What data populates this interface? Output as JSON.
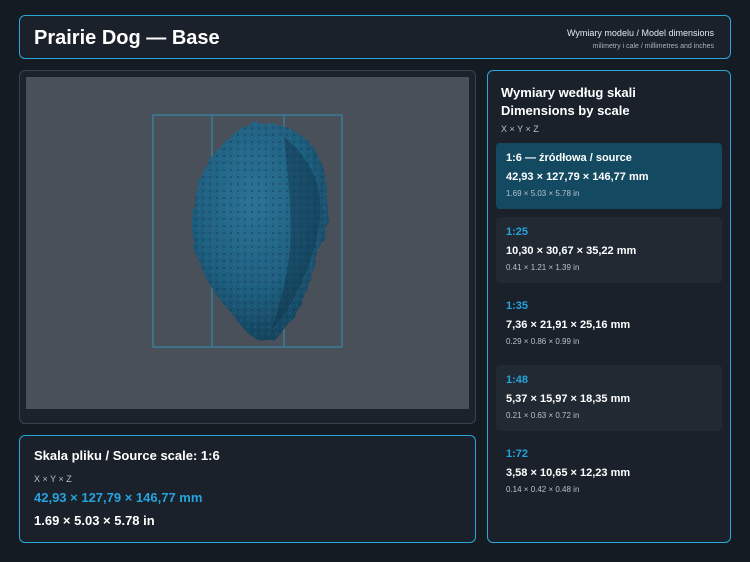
{
  "header": {
    "title": "Prairie Dog — Base",
    "subtitle_primary": "Wymiary modelu / Model dimensions",
    "subtitle_secondary": "milimetry i cale / millimetres and inches"
  },
  "viewer": {
    "background_color": "#4a5059",
    "model_color": "#1f5f80",
    "guide_color": "#2aa6d8"
  },
  "source": {
    "title": "Skala pliku / Source scale: 1:6",
    "axes": "X × Y × Z",
    "mm": "42,93 × 127,79 × 146,77 mm",
    "inches": "1.69 × 5.03 × 5.78 in"
  },
  "scales": {
    "title_pl": "Wymiary według skali",
    "title_en": "Dimensions by scale",
    "axes": "X × Y × Z",
    "items": [
      {
        "ratio": "1:6  —  źródłowa / source",
        "mm": "42,93 × 127,79 × 146,77 mm",
        "inches": "1.69 × 5.03 × 5.78 in"
      },
      {
        "ratio": "1:25",
        "mm": "10,30 × 30,67 × 35,22 mm",
        "inches": "0.41 × 1.21 × 1.39 in"
      },
      {
        "ratio": "1:35",
        "mm": "7,36 × 21,91 × 25,16 mm",
        "inches": "0.29 × 0.86 × 0.99 in"
      },
      {
        "ratio": "1:48",
        "mm": "5,37 × 15,97 × 18,35 mm",
        "inches": "0.21 × 0.63 × 0.72 in"
      },
      {
        "ratio": "1:72",
        "mm": "3,58 × 10,65 × 12,23 mm",
        "inches": "0.14 × 0.42 × 0.48 in"
      }
    ]
  },
  "colors": {
    "accent": "#26a3dd",
    "active_card": "#134a61",
    "panel_border": "#2aa6d8",
    "page_background": "#151b23"
  }
}
